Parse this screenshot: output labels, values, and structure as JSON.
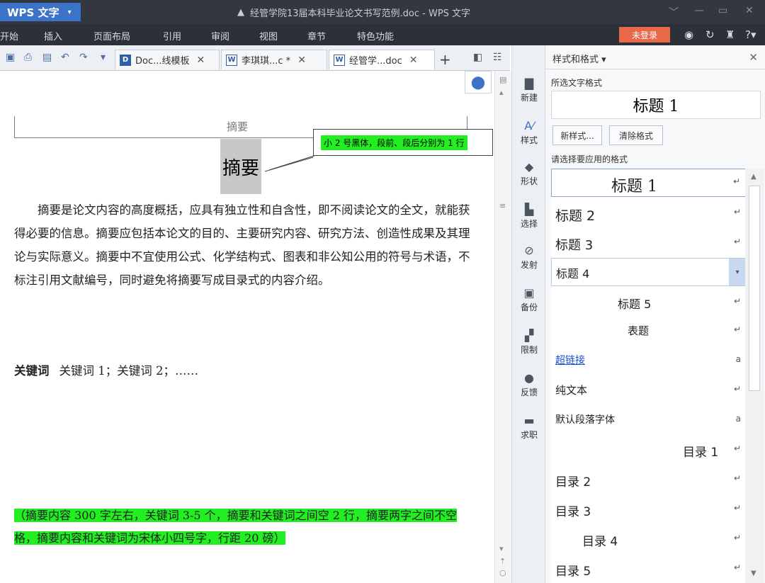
{
  "titlebar": {
    "app_name": "WPS 文字",
    "window_title": "经管学院13届本科毕业论文书写范例.doc - WPS 文字"
  },
  "menu": {
    "items": [
      "开始",
      "插入",
      "页面布局",
      "引用",
      "审阅",
      "视图",
      "章节",
      "特色功能"
    ],
    "login": "未登录"
  },
  "tabs": [
    {
      "label": "Doc...线模板"
    },
    {
      "label": "李琪琪...c *"
    },
    {
      "label": "经管学...doc"
    }
  ],
  "document": {
    "header_text": "摘要",
    "abstract_title": "摘要",
    "callout": "小 2 号黑体，段前、段后分别为 1 行",
    "body": "摘要是论文内容的高度概括，应具有独立性和自含性，即不阅读论文的全文，就能获得必要的信息。摘要应包括本论文的目的、主要研究内容、研究方法、创造性成果及其理论与实际意义。摘要中不宜使用公式、化学结构式、图表和非公知公用的符号与术语，不标注引用文献编号，同时避免将摘要写成目录式的内容介绍。",
    "keywords_label": "关键词",
    "keywords_value": "关键词 1；关键词 2；……",
    "note": "（摘要内容 300 字左右，关键词 3-5 个，摘要和关键词之间空 2 行，摘要两字之间不空格，摘要内容和关键词为宋体小四号字，行距 20 磅）"
  },
  "side_tools": [
    "新建",
    "样式",
    "形状",
    "选择",
    "发射",
    "备份",
    "限制",
    "反馈",
    "求职"
  ],
  "panel": {
    "title": "样式和格式 ▾",
    "selected_label": "所选文字格式",
    "current_style": "标题 1",
    "new_style_btn": "新样式...",
    "clear_format_btn": "清除格式",
    "choose_label": "请选择要应用的格式",
    "styles": [
      {
        "name": "标题 1",
        "mark": "↵"
      },
      {
        "name": "标题 2",
        "mark": "↵"
      },
      {
        "name": "标题 3",
        "mark": "↵"
      },
      {
        "name": "标题 4",
        "mark": "▾"
      },
      {
        "name": "标题 5",
        "mark": "↵"
      },
      {
        "name": "表题",
        "mark": "↵"
      },
      {
        "name": "超链接",
        "mark": "a"
      },
      {
        "name": "纯文本",
        "mark": "↵"
      },
      {
        "name": "默认段落字体",
        "mark": "a"
      },
      {
        "name": "目录 1",
        "mark": "↵"
      },
      {
        "name": "目录 2",
        "mark": "↵"
      },
      {
        "name": "目录 3",
        "mark": "↵"
      },
      {
        "name": "目录 4",
        "mark": "↵"
      },
      {
        "name": "目录 5",
        "mark": "↵"
      }
    ]
  },
  "colors": {
    "accent": "#3a73c8",
    "highlight": "#22ee22",
    "login": "#e8684a",
    "dark_bar": "#33373f"
  }
}
